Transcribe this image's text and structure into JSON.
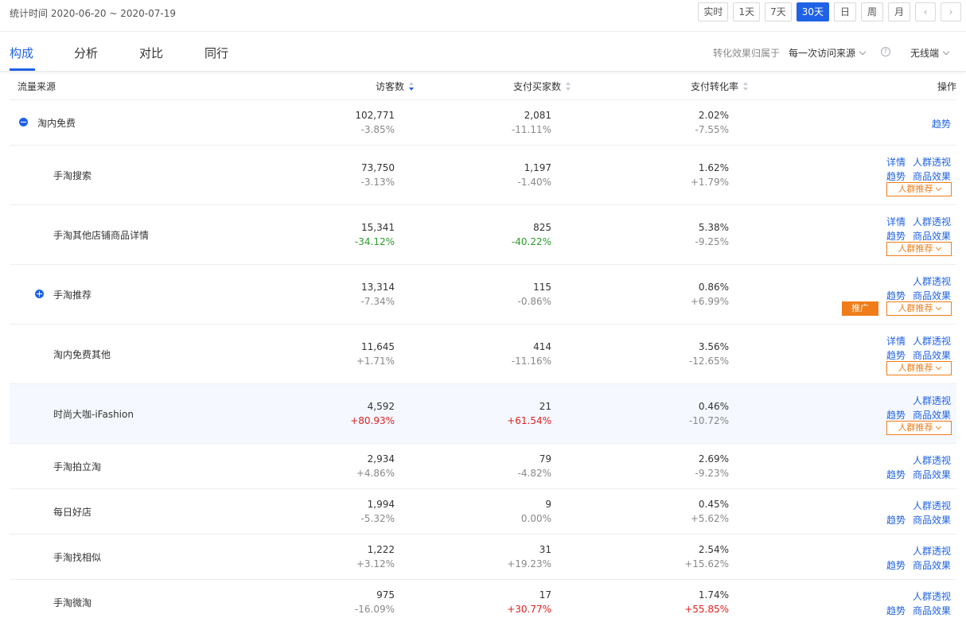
{
  "header": {
    "stat_time": "统计时间 2020-06-20 ~ 2020-07-19",
    "ranges": [
      {
        "label": "实时"
      },
      {
        "label": "1天"
      },
      {
        "label": "7天"
      },
      {
        "label": "30天",
        "active": true
      },
      {
        "label": "日"
      },
      {
        "label": "周"
      },
      {
        "label": "月"
      }
    ],
    "prev_icon": "chevron-left-icon",
    "next_icon": "chevron-right-icon"
  },
  "tabs": [
    {
      "label": "构成",
      "active": true
    },
    {
      "label": "分析"
    },
    {
      "label": "对比"
    },
    {
      "label": "同行"
    }
  ],
  "filters": {
    "attribution_label": "转化效果归属于",
    "attribution_value": "每一次访问来源",
    "help_icon": "question-circle-icon",
    "terminal_value": "无线端"
  },
  "columns": {
    "source": "流量来源",
    "visitors": "访客数",
    "buyers": "支付买家数",
    "rate": "支付转化率",
    "action": "操作"
  },
  "colors": {
    "accent": "#2062e6",
    "orange": "#f07d19",
    "up": "#e02020",
    "down": "#2a9a2a"
  },
  "labels": {
    "trend": "趋势",
    "detail": "详情",
    "crowd": "人群透视",
    "goods": "商品效果",
    "recommend": "人群推荐",
    "promote": "推广"
  },
  "rows": [
    {
      "name": "淘内免费",
      "visitors": "102,771",
      "visitors_chg": "-3.85%",
      "buyers": "2,081",
      "buyers_chg": "-11.11%",
      "rate": "2.02%",
      "rate_chg": "-7.55%"
    },
    {
      "name": "手淘搜索",
      "visitors": "73,750",
      "visitors_chg": "-3.13%",
      "buyers": "1,197",
      "buyers_chg": "-1.40%",
      "rate": "1.62%",
      "rate_chg": "+1.79%"
    },
    {
      "name": "手淘其他店铺商品详情",
      "visitors": "15,341",
      "visitors_chg": "-34.12%",
      "buyers": "825",
      "buyers_chg": "-40.22%",
      "rate": "5.38%",
      "rate_chg": "-9.25%"
    },
    {
      "name": "手淘推荐",
      "visitors": "13,314",
      "visitors_chg": "-7.34%",
      "buyers": "115",
      "buyers_chg": "-0.86%",
      "rate": "0.86%",
      "rate_chg": "+6.99%"
    },
    {
      "name": "淘内免费其他",
      "visitors": "11,645",
      "visitors_chg": "+1.71%",
      "buyers": "414",
      "buyers_chg": "-11.16%",
      "rate": "3.56%",
      "rate_chg": "-12.65%"
    },
    {
      "name": "时尚大咖-iFashion",
      "visitors": "4,592",
      "visitors_chg": "+80.93%",
      "buyers": "21",
      "buyers_chg": "+61.54%",
      "rate": "0.46%",
      "rate_chg": "-10.72%"
    },
    {
      "name": "手淘拍立淘",
      "visitors": "2,934",
      "visitors_chg": "+4.86%",
      "buyers": "79",
      "buyers_chg": "-4.82%",
      "rate": "2.69%",
      "rate_chg": "-9.23%"
    },
    {
      "name": "每日好店",
      "visitors": "1,994",
      "visitors_chg": "-5.32%",
      "buyers": "9",
      "buyers_chg": "0.00%",
      "rate": "0.45%",
      "rate_chg": "+5.62%"
    },
    {
      "name": "手淘找相似",
      "visitors": "1,222",
      "visitors_chg": "+3.12%",
      "buyers": "31",
      "buyers_chg": "+19.23%",
      "rate": "2.54%",
      "rate_chg": "+15.62%"
    },
    {
      "name": "手淘微淘",
      "visitors": "975",
      "visitors_chg": "-16.09%",
      "buyers": "17",
      "buyers_chg": "+30.77%",
      "rate": "1.74%",
      "rate_chg": "+55.85%"
    }
  ]
}
